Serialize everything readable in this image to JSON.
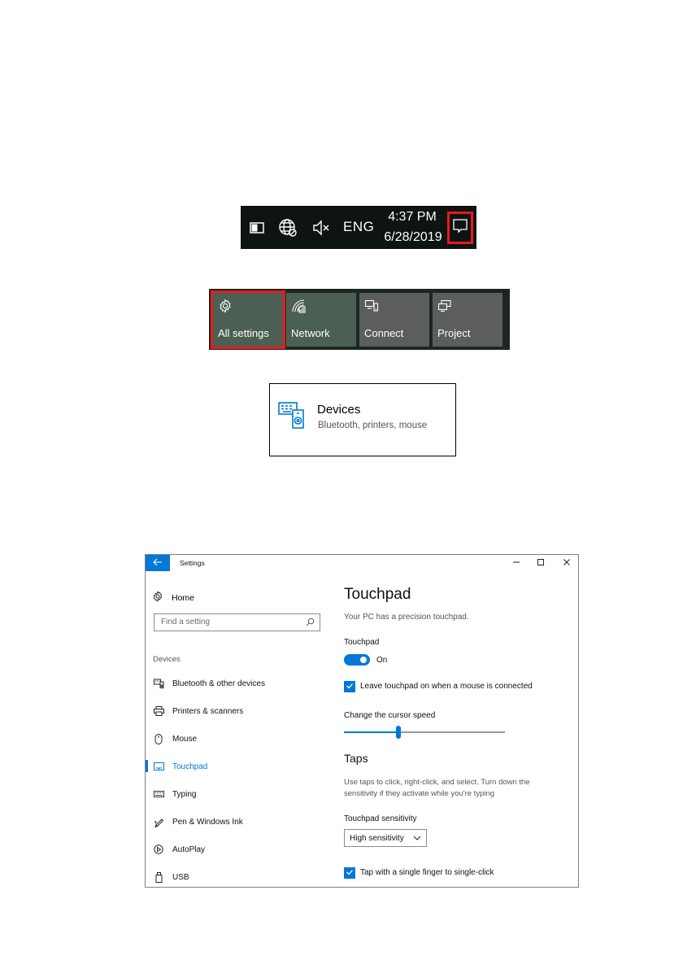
{
  "taskbar": {
    "language": "ENG",
    "time": "4:37 PM",
    "date": "6/28/2019",
    "icons": [
      "battery-icon",
      "network-globe-icon",
      "volume-muted-icon",
      "action-center-icon"
    ]
  },
  "quick_actions": {
    "tiles": [
      {
        "label": "All settings",
        "icon": "gear-icon"
      },
      {
        "label": "Network",
        "icon": "network-icon"
      },
      {
        "label": "Connect",
        "icon": "connect-icon"
      },
      {
        "label": "Project",
        "icon": "project-icon"
      }
    ]
  },
  "devices_card": {
    "title": "Devices",
    "subtitle": "Bluetooth, printers, mouse",
    "icon": "devices-icon"
  },
  "settings": {
    "window_title": "Settings",
    "nav": {
      "home": "Home",
      "search_placeholder": "Find a setting",
      "section": "Devices",
      "items": [
        {
          "label": "Bluetooth & other devices",
          "icon": "bluetooth-devices-icon"
        },
        {
          "label": "Printers & scanners",
          "icon": "printer-icon"
        },
        {
          "label": "Mouse",
          "icon": "mouse-icon"
        },
        {
          "label": "Touchpad",
          "icon": "touchpad-icon"
        },
        {
          "label": "Typing",
          "icon": "keyboard-icon"
        },
        {
          "label": "Pen & Windows Ink",
          "icon": "pen-icon"
        },
        {
          "label": "AutoPlay",
          "icon": "autoplay-icon"
        },
        {
          "label": "USB",
          "icon": "usb-icon"
        }
      ],
      "active_item": "Touchpad"
    },
    "content": {
      "title": "Touchpad",
      "subtitle": "Your PC has a precision touchpad.",
      "touchpad_label": "Touchpad",
      "toggle_state": "On",
      "leave_on_label": "Leave touchpad on when a mouse is connected",
      "cursor_speed_label": "Change the cursor speed",
      "cursor_speed_fraction": 0.34,
      "taps_title": "Taps",
      "taps_description": "Use taps to click, right-click, and select. Turn down the sensitivity if they activate while you're typing",
      "sensitivity_label": "Touchpad sensitivity",
      "sensitivity_value": "High sensitivity",
      "single_tap_label": "Tap with a single finger to single-click"
    }
  },
  "colors": {
    "accent": "#0078d7",
    "highlight": "#e51a23",
    "taskbar_bg": "#0e1411",
    "tile_bg": "#4b5f52"
  }
}
